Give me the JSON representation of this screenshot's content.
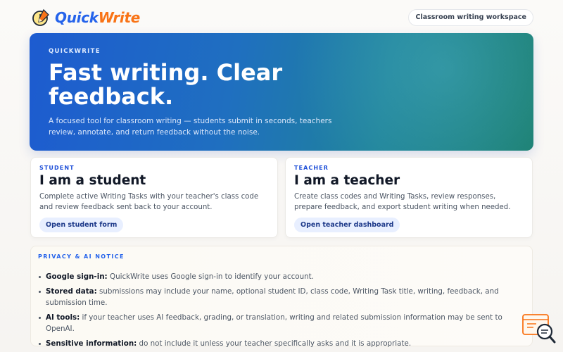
{
  "brand": {
    "name_part1": "Quick",
    "name_part2": "Write",
    "logo_icon": "pencil-clock-icon"
  },
  "header": {
    "workspace_label": "Classroom writing workspace"
  },
  "hero": {
    "eyebrow": "QUICKWRITE",
    "title": "Fast writing. Clear feedback.",
    "description": "A focused tool for classroom writing — students submit in seconds, teachers review, annotate, and return feedback without the noise."
  },
  "cards": {
    "student": {
      "eyebrow": "STUDENT",
      "title": "I am a student",
      "description": "Complete active Writing Tasks with your teacher's class code and review feedback sent back to your account.",
      "button": "Open student form"
    },
    "teacher": {
      "eyebrow": "TEACHER",
      "title": "I am a teacher",
      "description": "Create class codes and Writing Tasks, review responses, prepare feedback, and export student writing when needed.",
      "button": "Open teacher dashboard"
    }
  },
  "notice": {
    "eyebrow": "PRIVACY & AI NOTICE",
    "items": [
      {
        "label": "Google sign-in:",
        "text": " QuickWrite uses Google sign-in to identify your account."
      },
      {
        "label": "Stored data:",
        "text": " submissions may include your name, optional student ID, class code, Writing Task title, writing, feedback, and submission time."
      },
      {
        "label": "AI tools:",
        "text": " if your teacher uses AI feedback, grading, or translation, writing and related submission information may be sent to OpenAI."
      },
      {
        "label": "Sensitive information:",
        "text": " do not include it unless your teacher specifically asks and it is appropriate."
      }
    ]
  },
  "colors": {
    "primary": "#2563eb",
    "accent": "#f97316",
    "hero_end": "#1b7f70"
  },
  "floating": {
    "icon": "chat-search-icon"
  }
}
